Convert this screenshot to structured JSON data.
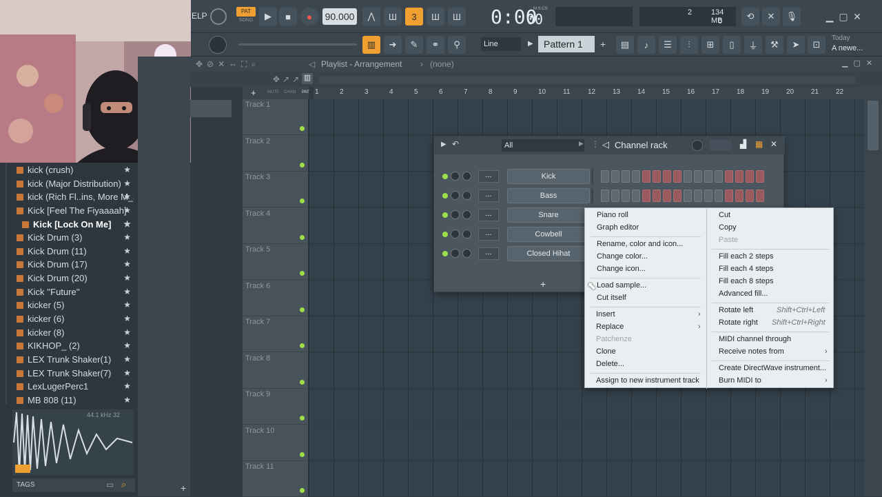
{
  "transport": {
    "pat_label": "PAT",
    "song_label": "SONG",
    "tempo": "90.000",
    "time": "0:00",
    "time_small": "00",
    "time_format": "M:S:CS",
    "cpu": "2",
    "memory": "134 MB",
    "voices": "0",
    "help_label": "ELP",
    "snap_mode": "Line",
    "pattern_name": "Pattern 1",
    "news_title": "Today",
    "news_text": "A newe..."
  },
  "browser": {
    "items": [
      {
        "label": "kick (crush)"
      },
      {
        "label": "kick (Major Distribution)"
      },
      {
        "label": "kick (Rich Fl..ins, More M_s)"
      },
      {
        "label": "Kick [Feel The Fiyaaaah]"
      },
      {
        "label": "Kick [Lock On Me]"
      },
      {
        "label": "Kick Drum (3)"
      },
      {
        "label": "Kick Drum (11)"
      },
      {
        "label": "Kick Drum (17)"
      },
      {
        "label": "Kick Drum (20)"
      },
      {
        "label": "Kick ''Future''"
      },
      {
        "label": "kicker (5)"
      },
      {
        "label": "kicker (6)"
      },
      {
        "label": "kicker (8)"
      },
      {
        "label": "KIKHOP_ (2)"
      },
      {
        "label": "LEX Trunk Shaker(1)"
      },
      {
        "label": "LEX Trunk Shaker(7)"
      },
      {
        "label": "LexLugerPerc1"
      },
      {
        "label": "MB 808 (11)"
      }
    ],
    "sample_info": "44.1 kHz 32",
    "tags_label": "TAGS"
  },
  "playlist": {
    "title": "Playlist - Arrangement",
    "pattern": "(none)",
    "ruler": [
      "1",
      "2",
      "3",
      "4",
      "5",
      "6",
      "7",
      "8",
      "9",
      "10",
      "11",
      "12",
      "13",
      "14",
      "15",
      "16",
      "17",
      "18",
      "19",
      "20",
      "21",
      "22"
    ],
    "tracks": [
      "Track 1",
      "Track 2",
      "Track 3",
      "Track 4",
      "Track 5",
      "Track 6",
      "Track 7",
      "Track 8",
      "Track 9",
      "Track 10",
      "Track 11"
    ],
    "mute_label": "MUTE",
    "chan_label": "CHAN",
    "pat_label": "PAT"
  },
  "channel_rack": {
    "title": "Channel rack",
    "filter": "All",
    "channels": [
      {
        "name": "Kick",
        "slot": "---"
      },
      {
        "name": "Bass",
        "slot": "---"
      },
      {
        "name": "Snare",
        "slot": "---"
      },
      {
        "name": "Cowbell",
        "slot": "---"
      },
      {
        "name": "Closed Hihat",
        "slot": "---"
      }
    ]
  },
  "context_menu": {
    "left": [
      {
        "label": "Piano roll",
        "disabled": false
      },
      {
        "label": "Graph editor",
        "disabled": false
      },
      {
        "label": "Rename, color and icon...",
        "disabled": false
      },
      {
        "label": "Change color...",
        "disabled": false
      },
      {
        "label": "Change icon...",
        "disabled": false
      },
      {
        "label": "Load sample...",
        "disabled": false
      },
      {
        "label": "Cut itself",
        "disabled": false
      },
      {
        "label": "Insert",
        "disabled": false,
        "submenu": true
      },
      {
        "label": "Replace",
        "disabled": false,
        "submenu": true
      },
      {
        "label": "Patchenze",
        "disabled": true
      },
      {
        "label": "Clone",
        "disabled": false
      },
      {
        "label": "Delete...",
        "disabled": false
      },
      {
        "label": "Assign to new instrument track",
        "disabled": false
      }
    ],
    "right": [
      {
        "label": "Cut",
        "disabled": false
      },
      {
        "label": "Copy",
        "disabled": false
      },
      {
        "label": "Paste",
        "disabled": true
      },
      {
        "label": "Fill each 2 steps",
        "disabled": false
      },
      {
        "label": "Fill each 4 steps",
        "disabled": false
      },
      {
        "label": "Fill each 8 steps",
        "disabled": false
      },
      {
        "label": "Advanced fill...",
        "disabled": false
      },
      {
        "label": "Rotate left",
        "shortcut": "Shift+Ctrl+Left",
        "disabled": false
      },
      {
        "label": "Rotate right",
        "shortcut": "Shift+Ctrl+Right",
        "disabled": false
      },
      {
        "label": "MIDI channel through",
        "disabled": false
      },
      {
        "label": "Receive notes from",
        "disabled": false,
        "submenu": true
      },
      {
        "label": "Create DirectWave instrument...",
        "disabled": false
      },
      {
        "label": "Burn MIDI to",
        "disabled": false,
        "submenu": true
      }
    ]
  },
  "colors": {
    "accent_orange": "#f0a030",
    "led_green": "#9fe04a",
    "step_red": "#9a5a5e",
    "record_red": "#ff5a4a"
  }
}
